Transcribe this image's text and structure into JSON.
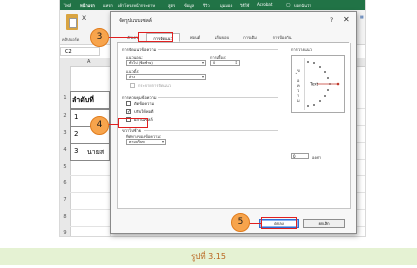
{
  "excel": {
    "ribbon_tabs": [
      "ไฟล์",
      "หน้าแรก",
      "แทรก",
      "เค้าโครงหน้ากระดาษ",
      "สูตร",
      "ข้อมูล",
      "รีวิว",
      "มุมมอง",
      "วิธีใช้",
      "Acrobat",
      "บอกฉันว่า"
    ],
    "paste_label": "คลิปบอร์ด",
    "clipboard_short": "Fi",
    "cut_glyph": "X",
    "name_box": "C2",
    "column_header": "A",
    "row_numbers": [
      "1",
      "2",
      "3",
      "4",
      "5",
      "6",
      "7",
      "8",
      "9"
    ],
    "cells": {
      "header": "ลำดับที่",
      "row2_tail": "1",
      "row3_tail": "2",
      "row4_num": "3",
      "row4_text": "นายส"
    }
  },
  "dialog": {
    "title": "จัดรูปแบบเซลล์",
    "help": "?",
    "close": "✕",
    "tabs": [
      "ตัวเลข",
      "การจัดแนว",
      "ฟอนต์",
      "เส้นขอบ",
      "การเติม",
      "การป้องกัน"
    ],
    "active_tab": "การจัดแนว",
    "text_alignment": {
      "section_label": "การจัดแนวข้อความ",
      "horizontal_label": "แนวนอน:",
      "horizontal_value": "ทั่วไป (ชิดซ้าย)",
      "vertical_label": "แนวตั้ง:",
      "vertical_value": "ล่าง",
      "indent_label": "การเยื้อง:",
      "indent_value": "0",
      "distributed_label": "กระจายการจัดแนว"
    },
    "text_control": {
      "section_label": "การควบคุมข้อความ",
      "wrap_text": "ตัดข้อความ",
      "shrink_to_fit": "ปรับให้พอดี",
      "merge_cells": "ผสานเซลล์",
      "shrink_checked": "✓"
    },
    "rtl": {
      "section_label": "ขวาไปซ้าย",
      "direction_label": "ทิศทางของข้อความ:",
      "direction_value": "ตามบริบท"
    },
    "orientation": {
      "section_label": "การวางแนว",
      "vertical_text": [
        "ข",
        "้",
        "อ",
        "ค",
        "ว",
        "า",
        "ม"
      ],
      "horizontal_text": "Text",
      "degrees_value": "0",
      "degrees_unit": "องศา"
    },
    "buttons": {
      "ok": "ตกลง",
      "cancel": "ยกเลิก"
    }
  },
  "annotations": {
    "markers": [
      "3",
      "4",
      "5"
    ],
    "marker_color": "#f7a44c",
    "line_color": "#e02020"
  },
  "caption": "รูปที่ 3.15",
  "colors": {
    "excel_green": "#217346",
    "caption_bg": "#e5f2d3",
    "caption_text": "#b8621c"
  }
}
